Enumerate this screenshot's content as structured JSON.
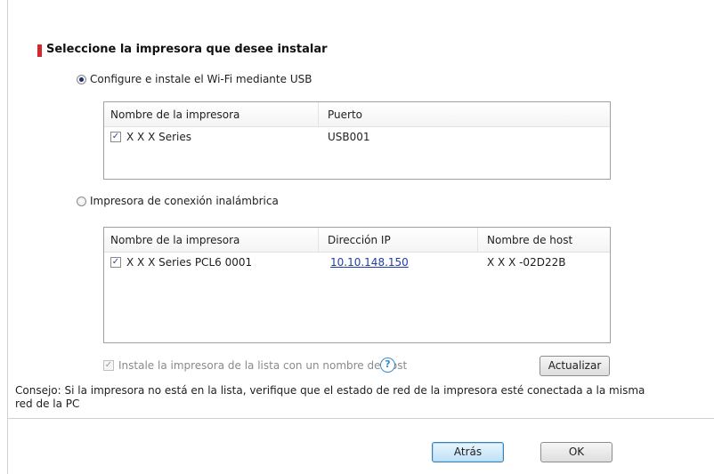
{
  "heading": "Seleccione la impresora que desee instalar",
  "usb_option": {
    "label": "Configure e instale el Wi-Fi mediante USB",
    "checked": true,
    "table": {
      "columns": [
        "Nombre de la impresora",
        "Puerto"
      ],
      "rows": [
        {
          "checked": true,
          "name": "X X X  Series",
          "port": "USB001"
        }
      ]
    }
  },
  "wireless_option": {
    "label": "Impresora de conexión inalámbrica",
    "checked": false,
    "table": {
      "columns": [
        "Nombre de la impresora",
        "Dirección IP",
        "Nombre de host"
      ],
      "rows": [
        {
          "checked": true,
          "name": "X X X  Series PCL6 0001",
          "ip": "10.10.148.150",
          "host": "X X X -02D22B"
        }
      ]
    }
  },
  "hostname_checkbox": {
    "label": "Instale la impresora de la lista con un nombre de host",
    "checked": true,
    "enabled": false
  },
  "refresh_button": "Actualizar",
  "tip": {
    "line1": "Consejo: Si la impresora no está en la lista, verifique que el estado de red de la impresora esté conectada a la misma",
    "line2": "red de la PC"
  },
  "buttons": {
    "back": "Atrás",
    "ok": "OK"
  },
  "icons": {
    "help": "question-mark-circle-icon",
    "check": "checkmark-icon"
  },
  "colors": {
    "accent_marker": "#d2282e",
    "link": "#1f3ea8"
  }
}
